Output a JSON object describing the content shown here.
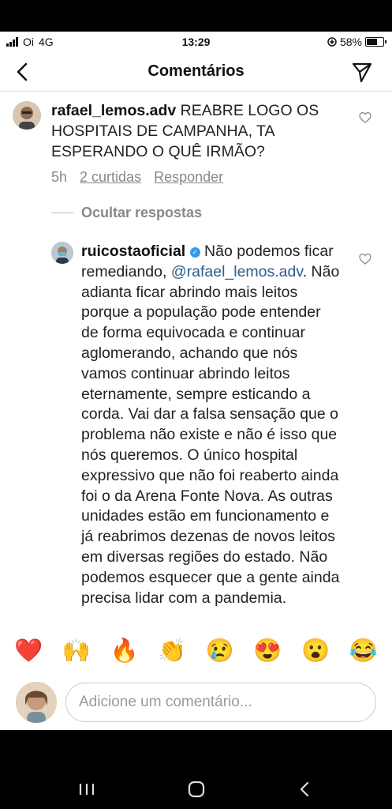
{
  "status_bar": {
    "carrier": "Oi",
    "network": "4G",
    "time": "13:29",
    "battery": "58%"
  },
  "header": {
    "title": "Comentários",
    "back_icon": "back-arrow-icon",
    "send_icon": "send-icon"
  },
  "comment": {
    "username": "rafael_lemos.adv",
    "text": " REABRE LOGO OS HOSPITAIS DE CAMPANHA, TA ESPERANDO O QUÊ IRMÃO?",
    "time": "5h",
    "likes": "2 curtidas",
    "reply": "Responder",
    "hide_replies": "Ocultar respostas"
  },
  "reply": {
    "username": "ruicostaoficial",
    "text_before": " Não podemos ficar remediando, ",
    "mention": "@rafael_lemos.adv",
    "text_after": ". Não adianta ficar abrindo mais leitos porque a população pode entender de forma equivocada e continuar aglomerando, achando que nós vamos continuar abrindo leitos eternamente, sempre esticando a corda. Vai dar a falsa sensação que o problema não existe e não é isso que nós queremos. O único hospital expressivo que não foi reaberto ainda foi o da Arena Fonte Nova. As outras unidades estão em funcionamento e já reabrimos dezenas de novos leitos em diversas regiões do estado. Não podemos esquecer que a gente ainda precisa lidar com a pandemia."
  },
  "emoji_bar": [
    "❤️",
    "🙌",
    "🔥",
    "👏",
    "😢",
    "😍",
    "😮",
    "😂"
  ],
  "comment_input": {
    "placeholder": "Adicione um comentário..."
  },
  "colors": {
    "mention": "#2f5c8a",
    "verified": "#3897f0",
    "muted": "#888888"
  }
}
